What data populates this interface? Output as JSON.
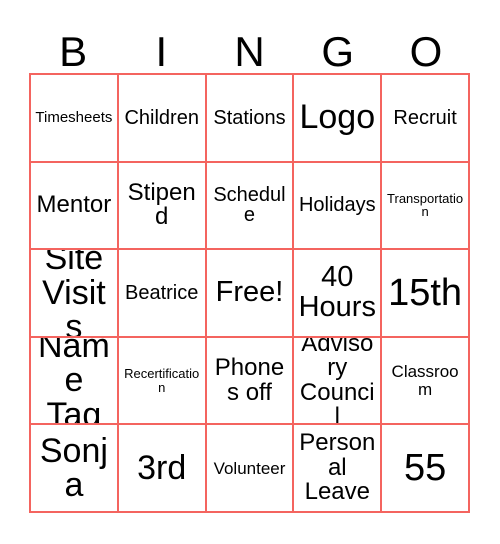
{
  "card": {
    "title": "BINGO Card",
    "border_color": "#f4645f",
    "text_color": "#000000",
    "background_color": "#ffffff"
  },
  "header": {
    "letters": [
      "B",
      "I",
      "N",
      "G",
      "O"
    ]
  },
  "grid": {
    "columns": 5,
    "rows": 5,
    "free_space": "Free!",
    "cells": [
      {
        "text": "Timesheets",
        "size": "fs-xs"
      },
      {
        "text": "Children",
        "size": "fs-m"
      },
      {
        "text": "Stations",
        "size": "fs-m"
      },
      {
        "text": "Logo",
        "size": "fs-xxl"
      },
      {
        "text": "Recruit",
        "size": "fs-m"
      },
      {
        "text": "Mentor",
        "size": "fs-l"
      },
      {
        "text": "Stipend",
        "size": "fs-l"
      },
      {
        "text": "Schedule",
        "size": "fs-m"
      },
      {
        "text": "Holidays",
        "size": "fs-m"
      },
      {
        "text": "Transportation",
        "size": "fs-xxs"
      },
      {
        "text": "Site Visits",
        "size": "fs-xxl"
      },
      {
        "text": "Beatrice",
        "size": "fs-m"
      },
      {
        "text": "Free!",
        "size": "fs-xl"
      },
      {
        "text": "40 Hours",
        "size": "fs-xl"
      },
      {
        "text": "15th",
        "size": "fs-huge"
      },
      {
        "text": "Name Tag",
        "size": "fs-xxl"
      },
      {
        "text": "Recertification",
        "size": "fs-xxs"
      },
      {
        "text": "Phones off",
        "size": "fs-l"
      },
      {
        "text": "Advisory Council",
        "size": "fs-l"
      },
      {
        "text": "Classroom",
        "size": "fs-s"
      },
      {
        "text": "Sonja",
        "size": "fs-xxl"
      },
      {
        "text": "3rd",
        "size": "fs-xxl"
      },
      {
        "text": "Volunteer",
        "size": "fs-s"
      },
      {
        "text": "Personal Leave",
        "size": "fs-l"
      },
      {
        "text": "55",
        "size": "fs-huge"
      }
    ]
  }
}
